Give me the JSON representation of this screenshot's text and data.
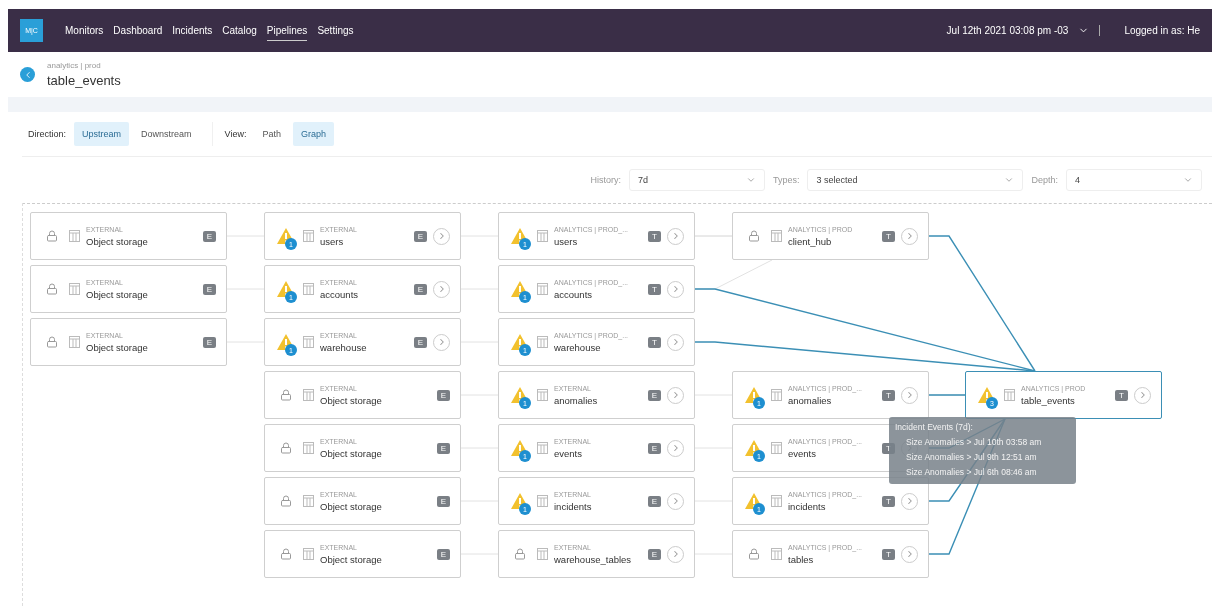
{
  "nav": {
    "logo": "M|C",
    "items": [
      {
        "label": "Monitors",
        "selected": false
      },
      {
        "label": "Dashboard",
        "selected": false
      },
      {
        "label": "Incidents",
        "selected": false
      },
      {
        "label": "Catalog",
        "selected": false
      },
      {
        "label": "Pipelines",
        "selected": true
      },
      {
        "label": "Settings",
        "selected": false
      }
    ],
    "date": "Jul 12th 2021 03:08 pm -03",
    "user": "Logged in as: He"
  },
  "header": {
    "breadcrumb": "analytics | prod",
    "title": "table_events"
  },
  "toolbar": {
    "direction_label": "Direction:",
    "directions": [
      {
        "label": "Upstream",
        "selected": true
      },
      {
        "label": "Downstream",
        "selected": false
      }
    ],
    "view_label": "View:",
    "views": [
      {
        "label": "Path",
        "selected": false
      },
      {
        "label": "Graph",
        "selected": true
      }
    ]
  },
  "filters": [
    {
      "label": "History:",
      "value": "7d"
    },
    {
      "label": "Types:",
      "value": "3 selected"
    },
    {
      "label": "Depth:",
      "value": "4"
    }
  ],
  "graph": {
    "columns": [
      [
        {
          "kind": "lock",
          "category": "EXTERNAL",
          "name": "Object storage",
          "badge": "E",
          "expandable": false,
          "highlighted": false,
          "on_path": false
        },
        {
          "kind": "lock",
          "category": "EXTERNAL",
          "name": "Object storage",
          "badge": "E",
          "expandable": false,
          "highlighted": false,
          "on_path": false
        },
        {
          "kind": "lock",
          "category": "EXTERNAL",
          "name": "Object storage",
          "badge": "E",
          "expandable": false,
          "highlighted": false,
          "on_path": false
        }
      ],
      [
        {
          "kind": "alert",
          "count": "1",
          "category": "EXTERNAL",
          "name": "users",
          "badge": "E",
          "expandable": true,
          "highlighted": false,
          "on_path": false
        },
        {
          "kind": "alert",
          "count": "1",
          "category": "EXTERNAL",
          "name": "accounts",
          "badge": "E",
          "expandable": true,
          "highlighted": false,
          "on_path": false
        },
        {
          "kind": "alert",
          "count": "1",
          "category": "EXTERNAL",
          "name": "warehouse",
          "badge": "E",
          "expandable": true,
          "highlighted": false,
          "on_path": false
        },
        {
          "kind": "lock",
          "category": "EXTERNAL",
          "name": "Object storage",
          "badge": "E",
          "expandable": false,
          "highlighted": false,
          "on_path": false
        },
        {
          "kind": "lock",
          "category": "EXTERNAL",
          "name": "Object storage",
          "badge": "E",
          "expandable": false,
          "highlighted": false,
          "on_path": false
        },
        {
          "kind": "lock",
          "category": "EXTERNAL",
          "name": "Object storage",
          "badge": "E",
          "expandable": false,
          "highlighted": false,
          "on_path": false
        },
        {
          "kind": "lock",
          "category": "EXTERNAL",
          "name": "Object storage",
          "badge": "E",
          "expandable": false,
          "highlighted": false,
          "on_path": false
        }
      ],
      [
        {
          "kind": "alert",
          "count": "1",
          "category": "ANALYTICS | PROD_...",
          "name": "users",
          "badge": "T",
          "expandable": true,
          "highlighted": false,
          "on_path": false
        },
        {
          "kind": "alert",
          "count": "1",
          "category": "ANALYTICS | PROD_...",
          "name": "accounts",
          "badge": "T",
          "expandable": true,
          "highlighted": false,
          "on_path": true
        },
        {
          "kind": "alert",
          "count": "1",
          "category": "ANALYTICS | PROD_...",
          "name": "warehouse",
          "badge": "T",
          "expandable": true,
          "highlighted": false,
          "on_path": true
        },
        {
          "kind": "alert",
          "count": "1",
          "category": "EXTERNAL",
          "name": "anomalies",
          "badge": "E",
          "expandable": true,
          "highlighted": false,
          "on_path": false
        },
        {
          "kind": "alert",
          "count": "1",
          "category": "EXTERNAL",
          "name": "events",
          "badge": "E",
          "expandable": true,
          "highlighted": false,
          "on_path": false
        },
        {
          "kind": "alert",
          "count": "1",
          "category": "EXTERNAL",
          "name": "incidents",
          "badge": "E",
          "expandable": true,
          "highlighted": false,
          "on_path": false
        },
        {
          "kind": "lock",
          "category": "EXTERNAL",
          "name": "warehouse_tables",
          "badge": "E",
          "expandable": true,
          "highlighted": false,
          "on_path": false
        }
      ],
      [
        {
          "kind": "lock",
          "category": "ANALYTICS | PROD",
          "name": "client_hub",
          "badge": "T",
          "expandable": true,
          "highlighted": false,
          "on_path": true
        },
        {
          "kind": "alert",
          "count": "1",
          "category": "ANALYTICS | PROD_...",
          "name": "anomalies",
          "badge": "T",
          "expandable": true,
          "highlighted": false,
          "on_path": true
        },
        {
          "kind": "alert",
          "count": "1",
          "category": "ANALYTICS | PROD_...",
          "name": "events",
          "badge": "T",
          "expandable": true,
          "highlighted": false,
          "on_path": true
        },
        {
          "kind": "alert",
          "count": "1",
          "category": "ANALYTICS | PROD_...",
          "name": "incidents",
          "badge": "T",
          "expandable": true,
          "highlighted": false,
          "on_path": true
        },
        {
          "kind": "lock",
          "category": "ANALYTICS | PROD_...",
          "name": "tables",
          "badge": "T",
          "expandable": true,
          "highlighted": false,
          "on_path": true
        }
      ],
      [
        {
          "kind": "alert",
          "count": "3",
          "category": "ANALYTICS | PROD",
          "name": "table_events",
          "badge": "T",
          "expandable": true,
          "highlighted": true,
          "on_path": false
        }
      ]
    ],
    "tooltip": {
      "title": "Incident Events (7d):",
      "lines": [
        "Size Anomalies > Jul 10th 03:58 am",
        "Size Anomalies > Jul 9th 12:51 am",
        "Size Anomalies > Jul 6th 08:46 am"
      ]
    }
  }
}
